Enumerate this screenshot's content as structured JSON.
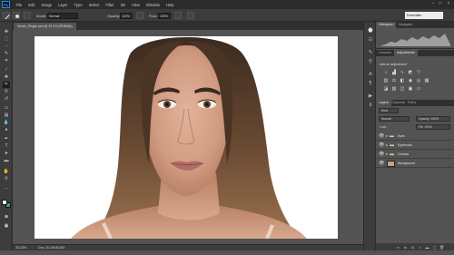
{
  "app": {
    "logo": "Ps",
    "menus": [
      "File",
      "Edit",
      "Image",
      "Layer",
      "Type",
      "Select",
      "Filter",
      "3D",
      "View",
      "Window",
      "Help"
    ]
  },
  "options_bar": {
    "mode_label": "Mode:",
    "mode_value": "Normal",
    "opacity_label": "Opacity:",
    "opacity_value": "100%",
    "flow_label": "Flow:",
    "flow_value": "100%",
    "workspace": "Essentials"
  },
  "document": {
    "tab_label": "Model_Single.psd @ 33.3% (RGB/8#)"
  },
  "status": {
    "zoom": "33.33%",
    "doc_info": "Doc: 20.1M/30.8M"
  },
  "panels": {
    "histogram_tabs": [
      "Histogram",
      "Navigator"
    ],
    "adjust_tabs": [
      "Libraries",
      "Adjustments"
    ],
    "adjust_title": "Add an adjustment",
    "layers_tabs": [
      "Layers",
      "Channels",
      "Paths"
    ],
    "kind_filter": "Kind",
    "blend_mode": "Normal",
    "opacity_label": "Opacity: 100%",
    "lock_label": "Lock:",
    "fill_label": "Fill: 100%"
  },
  "layers": [
    {
      "name": "Eyes",
      "type": "group"
    },
    {
      "name": "Eyebrows",
      "type": "group"
    },
    {
      "name": "Cheeks",
      "type": "group"
    },
    {
      "name": "Background",
      "type": "image"
    }
  ],
  "colors": {
    "foreground": "#ffffff",
    "background": "#3a9b8e",
    "ui_dark": "#2b2b2b",
    "ui_mid": "#535353"
  },
  "icons": {
    "toolbar": [
      "move-icon",
      "marquee-icon",
      "lasso-icon",
      "quick-select-icon",
      "crop-icon",
      "eyedropper-icon",
      "healing-icon",
      "brush-icon",
      "clone-stamp-icon",
      "history-brush-icon",
      "eraser-icon",
      "gradient-icon",
      "blur-icon",
      "dodge-icon",
      "pen-icon",
      "type-icon",
      "path-select-icon",
      "rectangle-icon",
      "hand-icon",
      "zoom-icon"
    ]
  }
}
